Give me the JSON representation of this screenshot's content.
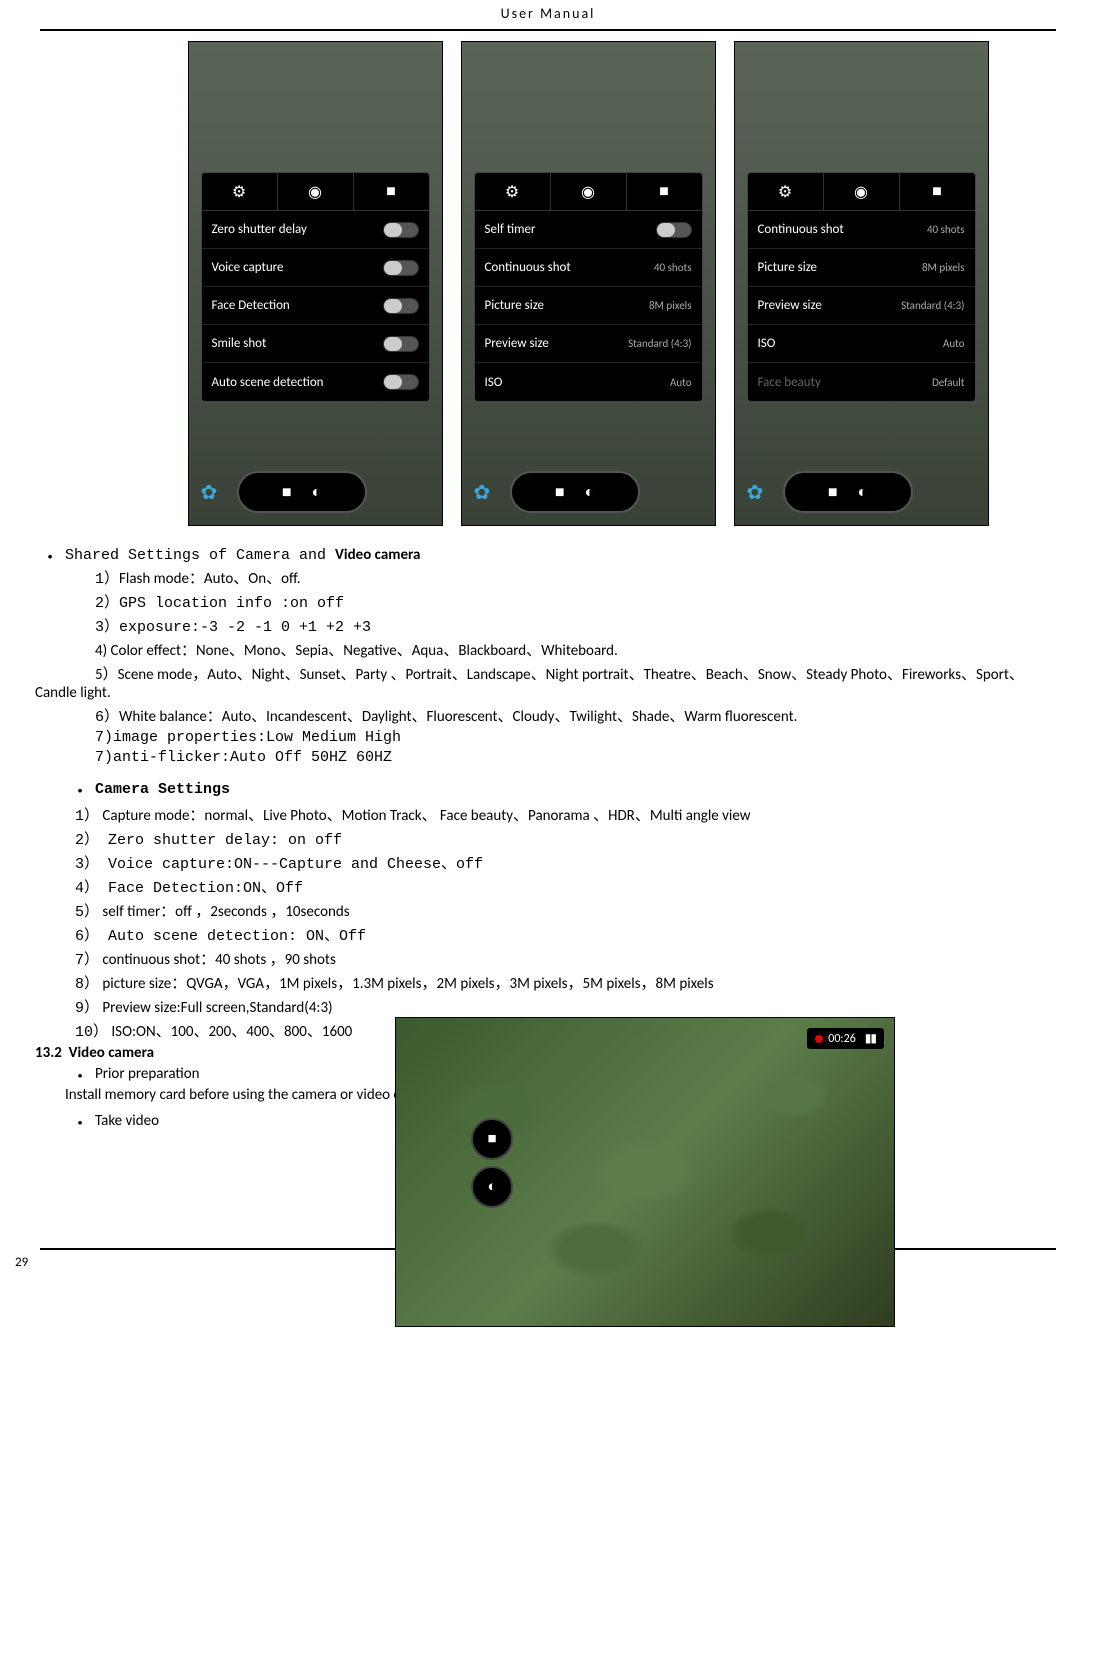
{
  "header": {
    "title": "User  Manual"
  },
  "screens": {
    "s1": {
      "rows": [
        {
          "label": "Zero shutter delay",
          "type": "toggle"
        },
        {
          "label": "Voice capture",
          "type": "toggle"
        },
        {
          "label": "Face Detection",
          "type": "toggle"
        },
        {
          "label": "Smile shot",
          "type": "toggle"
        },
        {
          "label": "Auto scene detection",
          "type": "toggle"
        }
      ]
    },
    "s2": {
      "rows": [
        {
          "label": "Self timer",
          "type": "toggle"
        },
        {
          "label": "Continuous shot",
          "value": "40 shots"
        },
        {
          "label": "Picture size",
          "value": "8M pixels"
        },
        {
          "label": "Preview size",
          "value": "Standard (4:3)"
        },
        {
          "label": "ISO",
          "value": "Auto"
        }
      ]
    },
    "s3": {
      "rows": [
        {
          "label": "Continuous shot",
          "value": "40 shots"
        },
        {
          "label": "Picture size",
          "value": "8M pixels"
        },
        {
          "label": "Preview size",
          "value": "Standard (4:3)"
        },
        {
          "label": "ISO",
          "value": "Auto"
        },
        {
          "label": "Face beauty",
          "value": "Default",
          "faded": true
        }
      ]
    }
  },
  "video_timer": "00:26",
  "text": {
    "shared_title_mono": "Shared Settings of Camera and ",
    "shared_title_bold": "Video camera",
    "l1a": "1）",
    "l1b": "Flash mode：Auto、On、off.",
    "l2": "2）GPS location info :on   off",
    "l3": "3）exposure:-3  -2  -1  0  +1  +2  +3",
    "l4": "4)   Color effect：None、Mono、Sepia、Negative、Aqua、Blackboard、Whiteboard.",
    "l5": "5）Scene mode，Auto、Night、Sunset、Party 、Portrait、Landscape、Night portrait、Theatre、Beach、Snow、Steady Photo、Fireworks、Sport、Candle light.",
    "l6a": "6）",
    "l6b": "White balance：Auto、Incandescent、Daylight、Fluorescent、Cloudy、Twilight、Shade、Warm fluorescent.",
    "l7": "7)image properties:Low  Medium  High",
    "l8": "7)anti-flicker:Auto  Off  50HZ  60HZ",
    "cam_title": "Camera Settings",
    "c1a": "1）",
    "c1b": " Capture mode：normal、Live Photo、Motion Track、  Face beauty、Panorama   、HDR、Multi angle view",
    "c2": "2） Zero shutter delay: on  off",
    "c3": "3） Voice capture:ON---Capture and Cheese、off",
    "c4": "4） Face Detection:ON、Off",
    "c5a": "5）",
    "c5b": " self timer：off ，2seconds ，10seconds",
    "c6": "6） Auto scene detection: ON、Off",
    "c7a": "7）",
    "c7b": " continuous shot：40 shots ，90 shots",
    "c8a": "8）",
    "c8b": " picture size：QVGA，VGA，1M pixels，1.3M pixels，2M pixels，3M pixels，5M pixels，8M pixels",
    "c9a": "9）",
    "c9b": " Preview size:Full screen,Standard(4:3)",
    "c10a": "10）",
    "c10b": "   ISO:ON、100、200、400、800、1600",
    "sec_num": "13.2",
    "sec_title": "Video camera",
    "prior": "Prior preparation",
    "prior_desc": "Install memory card before using the camera or video camera. All your photos or videos taken by the phone are stored in memory card.",
    "take": "Take video",
    "page": "29"
  }
}
